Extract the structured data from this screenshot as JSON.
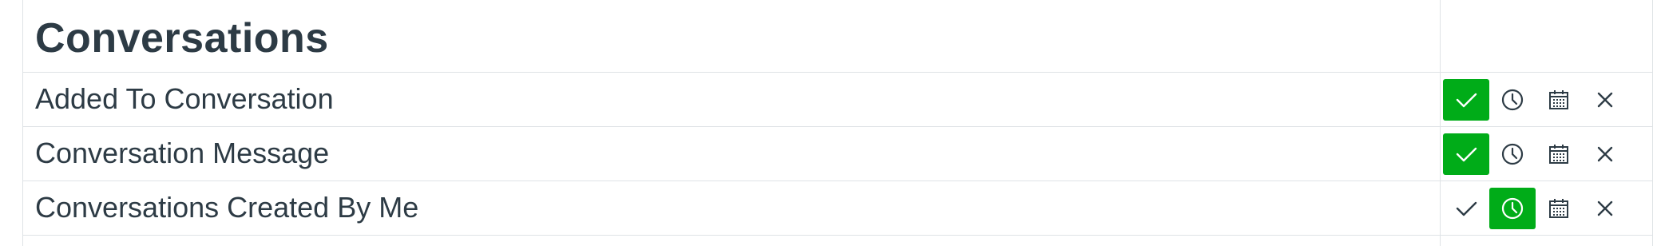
{
  "category": {
    "title": "Conversations"
  },
  "rows": [
    {
      "label": "Added To Conversation",
      "selected": "immediately"
    },
    {
      "label": "Conversation Message",
      "selected": "immediately"
    },
    {
      "label": "Conversations Created By Me",
      "selected": "daily"
    }
  ],
  "options": [
    {
      "key": "immediately",
      "icon": "check-icon"
    },
    {
      "key": "daily",
      "icon": "clock-icon"
    },
    {
      "key": "weekly",
      "icon": "calendar-icon"
    },
    {
      "key": "never",
      "icon": "x-icon"
    }
  ],
  "colors": {
    "active": "#00ac18",
    "text": "#2d3b45",
    "border": "#dfe3e6"
  }
}
